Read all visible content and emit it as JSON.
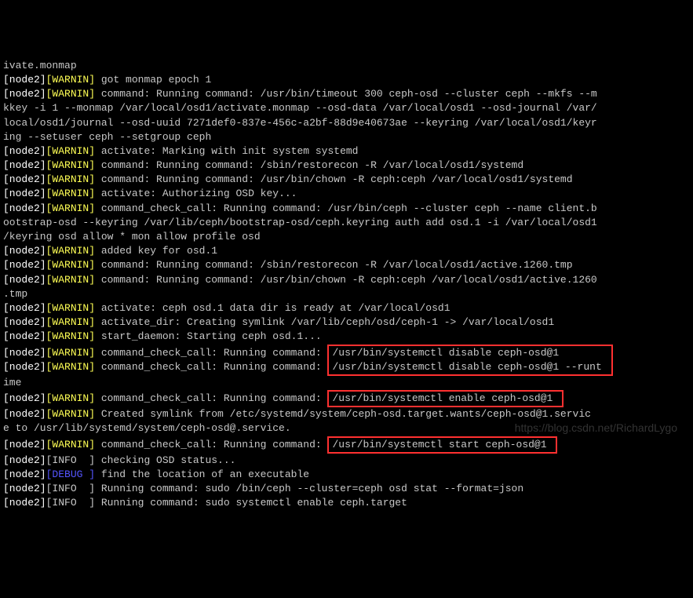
{
  "lines": [
    {
      "segments": [
        {
          "cls": "grey",
          "text": "ivate.monmap"
        }
      ]
    },
    {
      "segments": [
        {
          "cls": "white",
          "text": "[node2]"
        },
        {
          "cls": "yellow",
          "text": "[WARNIN]"
        },
        {
          "cls": "grey",
          "text": " got monmap epoch 1"
        }
      ]
    },
    {
      "segments": [
        {
          "cls": "white",
          "text": "[node2]"
        },
        {
          "cls": "yellow",
          "text": "[WARNIN]"
        },
        {
          "cls": "grey",
          "text": " command: Running command: /usr/bin/timeout 300 ceph-osd --cluster ceph --mkfs --m"
        }
      ]
    },
    {
      "segments": [
        {
          "cls": "grey",
          "text": "kkey -i 1 --monmap /var/local/osd1/activate.monmap --osd-data /var/local/osd1 --osd-journal /var/"
        }
      ]
    },
    {
      "segments": [
        {
          "cls": "grey",
          "text": "local/osd1/journal --osd-uuid 7271def0-837e-456c-a2bf-88d9e40673ae --keyring /var/local/osd1/keyr"
        }
      ]
    },
    {
      "segments": [
        {
          "cls": "grey",
          "text": "ing --setuser ceph --setgroup ceph"
        }
      ]
    },
    {
      "segments": [
        {
          "cls": "white",
          "text": "[node2]"
        },
        {
          "cls": "yellow",
          "text": "[WARNIN]"
        },
        {
          "cls": "grey",
          "text": " activate: Marking with init system systemd"
        }
      ]
    },
    {
      "segments": [
        {
          "cls": "white",
          "text": "[node2]"
        },
        {
          "cls": "yellow",
          "text": "[WARNIN]"
        },
        {
          "cls": "grey",
          "text": " command: Running command: /sbin/restorecon -R /var/local/osd1/systemd"
        }
      ]
    },
    {
      "segments": [
        {
          "cls": "white",
          "text": "[node2]"
        },
        {
          "cls": "yellow",
          "text": "[WARNIN]"
        },
        {
          "cls": "grey",
          "text": " command: Running command: /usr/bin/chown -R ceph:ceph /var/local/osd1/systemd"
        }
      ]
    },
    {
      "segments": [
        {
          "cls": "white",
          "text": "[node2]"
        },
        {
          "cls": "yellow",
          "text": "[WARNIN]"
        },
        {
          "cls": "grey",
          "text": " activate: Authorizing OSD key..."
        }
      ]
    },
    {
      "segments": [
        {
          "cls": "white",
          "text": "[node2]"
        },
        {
          "cls": "yellow",
          "text": "[WARNIN]"
        },
        {
          "cls": "grey",
          "text": " command_check_call: Running command: /usr/bin/ceph --cluster ceph --name client.b"
        }
      ]
    },
    {
      "segments": [
        {
          "cls": "grey",
          "text": "ootstrap-osd --keyring /var/lib/ceph/bootstrap-osd/ceph.keyring auth add osd.1 -i /var/local/osd1"
        }
      ]
    },
    {
      "segments": [
        {
          "cls": "grey",
          "text": "/keyring osd allow * mon allow profile osd"
        }
      ]
    },
    {
      "segments": [
        {
          "cls": "white",
          "text": "[node2]"
        },
        {
          "cls": "yellow",
          "text": "[WARNIN]"
        },
        {
          "cls": "grey",
          "text": " added key for osd.1"
        }
      ]
    },
    {
      "segments": [
        {
          "cls": "white",
          "text": "[node2]"
        },
        {
          "cls": "yellow",
          "text": "[WARNIN]"
        },
        {
          "cls": "grey",
          "text": " command: Running command: /sbin/restorecon -R /var/local/osd1/active.1260.tmp"
        }
      ]
    },
    {
      "segments": [
        {
          "cls": "white",
          "text": "[node2]"
        },
        {
          "cls": "yellow",
          "text": "[WARNIN]"
        },
        {
          "cls": "grey",
          "text": " command: Running command: /usr/bin/chown -R ceph:ceph /var/local/osd1/active.1260"
        }
      ]
    },
    {
      "segments": [
        {
          "cls": "grey",
          "text": ".tmp"
        }
      ]
    },
    {
      "segments": [
        {
          "cls": "white",
          "text": "[node2]"
        },
        {
          "cls": "yellow",
          "text": "[WARNIN]"
        },
        {
          "cls": "grey",
          "text": " activate: ceph osd.1 data dir is ready at /var/local/osd1"
        }
      ]
    },
    {
      "segments": [
        {
          "cls": "white",
          "text": "[node2]"
        },
        {
          "cls": "yellow",
          "text": "[WARNIN]"
        },
        {
          "cls": "grey",
          "text": " activate_dir: Creating symlink /var/lib/ceph/osd/ceph-1 -> /var/local/osd1"
        }
      ]
    },
    {
      "segments": [
        {
          "cls": "white",
          "text": "[node2]"
        },
        {
          "cls": "yellow",
          "text": "[WARNIN]"
        },
        {
          "cls": "grey",
          "text": " start_daemon: Starting ceph osd.1..."
        }
      ]
    },
    {
      "segments": [
        {
          "cls": "white",
          "text": "[node2]"
        },
        {
          "cls": "yellow",
          "text": "[WARNIN]"
        },
        {
          "cls": "grey",
          "text": " command_check_call: Running command: "
        },
        {
          "cls": "grey redbox-top",
          "box": "box1",
          "text": "/usr/bin/systemctl disable ceph-osd@1        "
        }
      ]
    },
    {
      "segments": [
        {
          "cls": "white",
          "text": "[node2]"
        },
        {
          "cls": "yellow",
          "text": "[WARNIN]"
        },
        {
          "cls": "grey",
          "text": " command_check_call: Running command: "
        },
        {
          "cls": "grey redbox-bot",
          "box": "box1",
          "text": "/usr/bin/systemctl disable ceph-osd@1 --runt "
        }
      ]
    },
    {
      "segments": [
        {
          "cls": "grey",
          "text": "ime"
        }
      ]
    },
    {
      "segments": [
        {
          "cls": "white",
          "text": "[node2]"
        },
        {
          "cls": "yellow",
          "text": "[WARNIN]"
        },
        {
          "cls": "grey",
          "text": " command_check_call: Running command: "
        },
        {
          "cls": "grey redbox",
          "box": "box2",
          "text": "/usr/bin/systemctl enable ceph-osd@1 "
        }
      ]
    },
    {
      "segments": [
        {
          "cls": "white",
          "text": "[node2]"
        },
        {
          "cls": "yellow",
          "text": "[WARNIN]"
        },
        {
          "cls": "grey",
          "text": " Created symlink from /etc/systemd/system/ceph-osd.target.wants/ceph-osd@1.servic"
        }
      ]
    },
    {
      "segments": [
        {
          "cls": "grey",
          "text": "e to /usr/lib/systemd/system/ceph-osd@.service."
        }
      ]
    },
    {
      "segments": [
        {
          "cls": "white",
          "text": "[node2]"
        },
        {
          "cls": "yellow",
          "text": "[WARNIN]"
        },
        {
          "cls": "grey",
          "text": " command_check_call: Running command: "
        },
        {
          "cls": "grey redbox",
          "box": "box3",
          "text": "/usr/bin/systemctl start ceph-osd@1 "
        }
      ]
    },
    {
      "segments": [
        {
          "cls": "white",
          "text": "[node2]"
        },
        {
          "cls": "grey",
          "text": "[INFO  ]"
        },
        {
          "cls": "grey",
          "text": " checking OSD status..."
        }
      ]
    },
    {
      "segments": [
        {
          "cls": "white",
          "text": "[node2]"
        },
        {
          "cls": "blue",
          "text": "[DEBUG ]"
        },
        {
          "cls": "grey",
          "text": " find the location of an executable"
        }
      ]
    },
    {
      "segments": [
        {
          "cls": "white",
          "text": "[node2]"
        },
        {
          "cls": "grey",
          "text": "[INFO  ]"
        },
        {
          "cls": "grey",
          "text": " Running command: sudo /bin/ceph --cluster=ceph osd stat --format=json"
        }
      ]
    },
    {
      "segments": [
        {
          "cls": "white",
          "text": "[node2]"
        },
        {
          "cls": "grey",
          "text": "[INFO  ]"
        },
        {
          "cls": "grey",
          "text": " Running command: sudo systemctl enable ceph.target"
        }
      ]
    }
  ],
  "watermark": "https://blog.csdn.net/RichardLygo"
}
